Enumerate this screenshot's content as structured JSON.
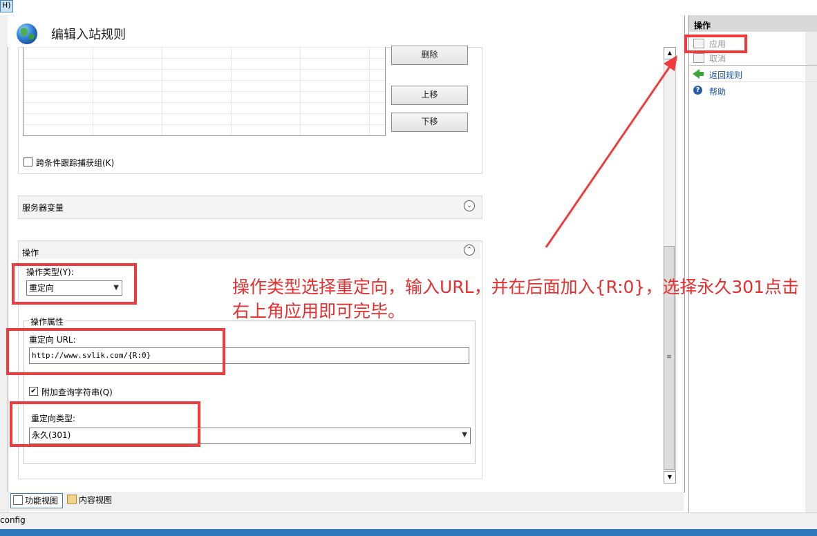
{
  "menu": {
    "help_fragment": "H)"
  },
  "header": {
    "title": "编辑入站规则"
  },
  "conditions": {
    "delete_button": "删除",
    "move_up_button": "上移",
    "move_down_button": "下移",
    "track_groups_label": "跨条件跟踪捕获组(K)"
  },
  "server_vars": {
    "title": "服务器变量"
  },
  "action": {
    "title": "操作",
    "type_label": "操作类型(Y):",
    "type_value": "重定向",
    "props_label": "操作属性",
    "url_label": "重定向 URL:",
    "url_value": "http://www.svlik.com/{R:0}",
    "append_query_label": "附加查询字符串(Q)",
    "append_query_checked": true,
    "redirect_type_label": "重定向类型:",
    "redirect_type_value": "永久(301)"
  },
  "views": {
    "feature_view": "功能视图",
    "content_view": "内容视图"
  },
  "status": {
    "text": "config"
  },
  "actions_pane": {
    "title": "操作",
    "apply": "应用",
    "cancel": "取消",
    "back_to_rules": "返回规则",
    "help": "帮助"
  },
  "annotation": {
    "text": "操作类型选择重定向，输入URL，并在后面加入{R:0}，选择永久301点击右上角应用即可完毕。",
    "color": "#e53030"
  }
}
